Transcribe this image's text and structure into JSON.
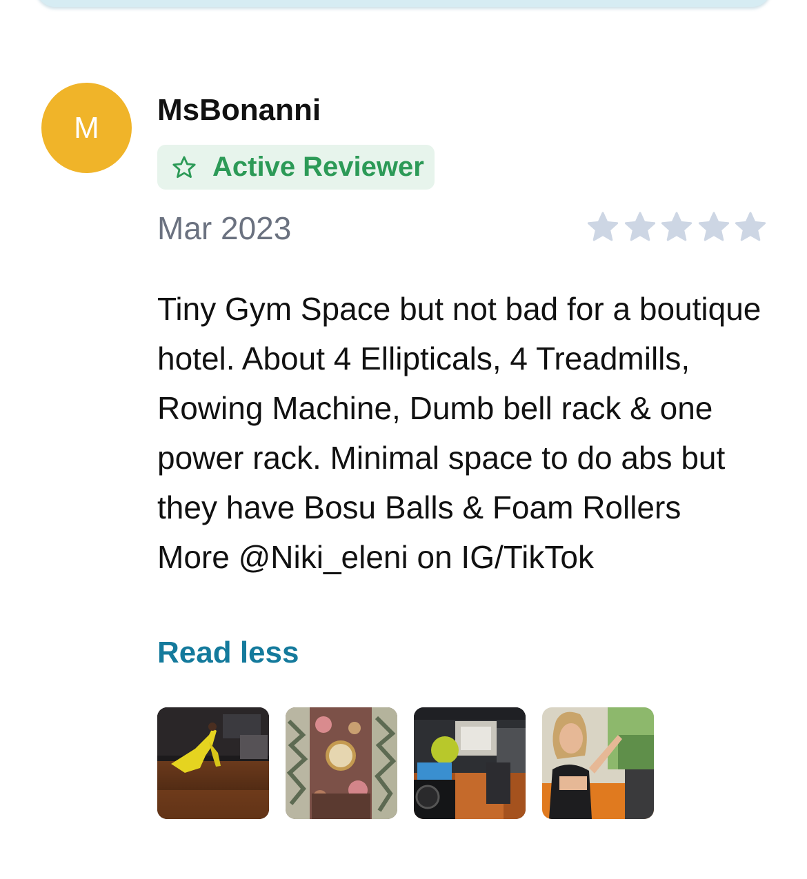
{
  "review": {
    "avatar_initial": "M",
    "avatar_color": "#f0b429",
    "username": "MsBonanni",
    "badge": {
      "label": "Active Reviewer",
      "icon": "star-outline-icon",
      "color": "#2c9a57",
      "background": "#e7f4ec"
    },
    "date": "Mar 2023",
    "rating": {
      "value": 0,
      "max": 5,
      "empty_color": "#cdd6e4"
    },
    "text": "Tiny Gym Space but not bad for a boutique hotel. About 4 Ellipticals, 4 Treadmills, Rowing Machine, Dumb bell rack & one power rack. Minimal space to do abs but they have Bosu Balls & Foam Rollers",
    "text_more": "More @Niki_eleni on IG/TikTok",
    "read_less_label": "Read less",
    "read_less_color": "#147a9c",
    "photos": [
      {
        "name": "photo-gym-floor"
      },
      {
        "name": "photo-wallpaper-mirror"
      },
      {
        "name": "photo-gym-equipment"
      },
      {
        "name": "photo-reviewer-selfie"
      }
    ]
  }
}
